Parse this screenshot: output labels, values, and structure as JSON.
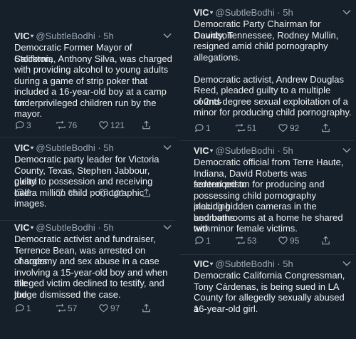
{
  "author": {
    "name": "VIC",
    "badge": "♥",
    "handle": "@SubtleBodhi",
    "time": "5h"
  },
  "left_column": [
    {
      "lines": [
        "Democratic Former Mayor of Stockton,",
        "California, Anthony Silva, was charged",
        "with providing alcohol to young adults",
        "during a game of strip poker that",
        "included a 16-year-old boy at a camp for",
        "underprivileged children run by the",
        "mayor."
      ],
      "replies": "3",
      "retweets": "76",
      "likes": "121"
    },
    {
      "lines": [
        "Democratic party leader for Victoria",
        "County, Texas, Stephen Jabbour, plead",
        "guilty to possession and receiving over",
        "half a million child pornographic images."
      ],
      "replies": "3",
      "retweets": "65",
      "likes": "101"
    },
    {
      "lines": [
        "Democratic activist and fundraiser,",
        "Terrence Bean, was arrested on charges",
        "of sodomy and sex abuse in a case",
        "involving a 15-year-old boy and when the",
        "alleged victim declined to testify, and the",
        "judge dismissed the case."
      ],
      "replies": "1",
      "retweets": "57",
      "likes": "97"
    }
  ],
  "right_column": [
    {
      "lines": [
        "Democratic Party Chairman for Davidson",
        "County, Tennessee, Rodney Mullin,",
        "resigned amid child pornography",
        "allegations.",
        "",
        "Democratic activist, Andrew Douglas",
        "Reed, pleaded guilty to a multiple counts",
        "of 2nd-degree sexual exploitation of a",
        "minor for producing child pornography."
      ],
      "replies": "1",
      "retweets": "51",
      "likes": "92"
    },
    {
      "lines": [
        "Democratic official from Terre Haute,",
        "Indiana, David Roberts was sentenced to",
        "federal prison for producing and",
        "possessing child pornography including",
        "placing hidden cameras in the bedrooms",
        "and bathrooms at a home he shared with",
        "two minor female victims."
      ],
      "replies": "1",
      "retweets": "53",
      "likes": "95"
    },
    {
      "lines": [
        "Democratic California Congressman,",
        "Tony Cárdenas, is being sued in LA",
        "County for allegedly sexually abused a",
        "16-year-old girl."
      ],
      "replies": "",
      "retweets": "",
      "likes": ""
    }
  ],
  "icons": {
    "reply": "reply-icon",
    "retweet": "retweet-icon",
    "like": "like-icon",
    "share": "share-icon",
    "caret": "chevron-down-icon"
  },
  "colors": {
    "background": "#15202b",
    "text": "#e7e9ea",
    "muted": "#9aa6b2"
  }
}
